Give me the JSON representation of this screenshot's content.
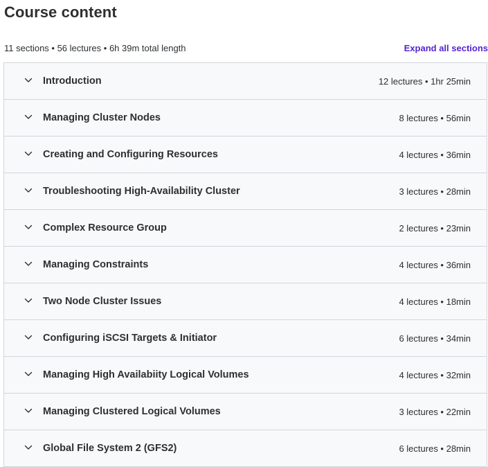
{
  "header": {
    "title": "Course content",
    "summary": "11 sections • 56 lectures • 6h 39m total length",
    "expand_all_label": "Expand all sections"
  },
  "sections": [
    {
      "title": "Introduction",
      "meta": "12 lectures • 1hr 25min",
      "icon": "chevron-down-icon"
    },
    {
      "title": "Managing Cluster Nodes",
      "meta": "8 lectures • 56min",
      "icon": "chevron-down-icon"
    },
    {
      "title": "Creating and Configuring Resources",
      "meta": "4 lectures • 36min",
      "icon": "chevron-down-icon"
    },
    {
      "title": "Troubleshooting High-Availability Cluster",
      "meta": "3 lectures • 28min",
      "icon": "chevron-down-icon"
    },
    {
      "title": "Complex Resource Group",
      "meta": "2 lectures • 23min",
      "icon": "chevron-down-icon"
    },
    {
      "title": "Managing Constraints",
      "meta": "4 lectures • 36min",
      "icon": "chevron-down-icon"
    },
    {
      "title": "Two Node Cluster Issues",
      "meta": "4 lectures • 18min",
      "icon": "chevron-down-icon"
    },
    {
      "title": "Configuring iSCSI Targets & Initiator",
      "meta": "6 lectures • 34min",
      "icon": "chevron-down-icon"
    },
    {
      "title": "Managing High Availabiity Logical Volumes",
      "meta": "4 lectures • 32min",
      "icon": "chevron-down-icon"
    },
    {
      "title": "Managing Clustered Logical Volumes",
      "meta": "3 lectures • 22min",
      "icon": "chevron-down-icon"
    },
    {
      "title": "Global File System 2 (GFS2)",
      "meta": "6 lectures • 28min",
      "icon": "chevron-down-icon"
    }
  ],
  "colors": {
    "accent": "#5624d0",
    "text": "#2d2f31",
    "section_bg": "#f7f9fa",
    "border": "#d1d7dc"
  }
}
